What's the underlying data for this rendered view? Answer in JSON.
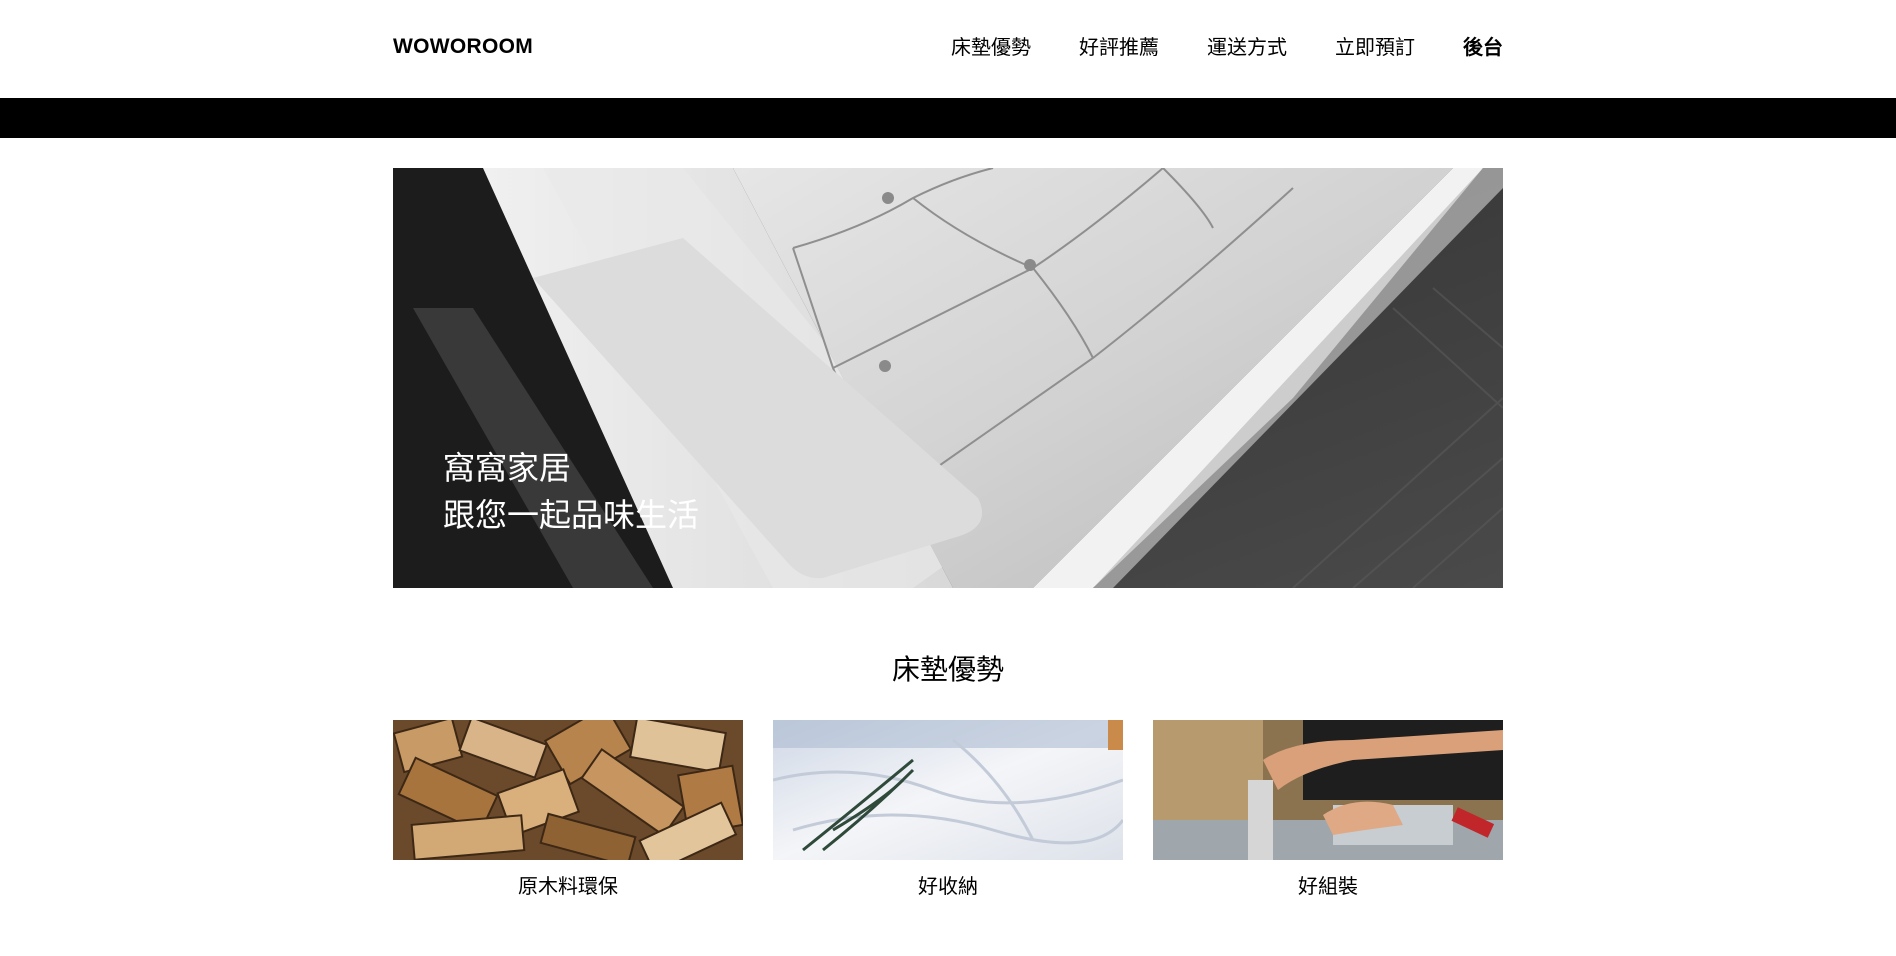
{
  "header": {
    "logo": "WOWOROOM",
    "nav": [
      {
        "label": "床墊優勢"
      },
      {
        "label": "好評推薦"
      },
      {
        "label": "運送方式"
      },
      {
        "label": "立即預訂"
      },
      {
        "label": "後台"
      }
    ]
  },
  "hero": {
    "line1": "窩窩家居",
    "line2": "跟您一起品味生活",
    "image": "leather-chair-photo"
  },
  "advantages": {
    "title": "床墊優勢",
    "items": [
      {
        "label": "原木料環保",
        "image": "firewood-photo"
      },
      {
        "label": "好收納",
        "image": "white-bedding-photo"
      },
      {
        "label": "好組裝",
        "image": "assembly-photo"
      }
    ]
  },
  "colors": {
    "background": "#ffffff",
    "bar": "#000000",
    "text": "#000000"
  }
}
